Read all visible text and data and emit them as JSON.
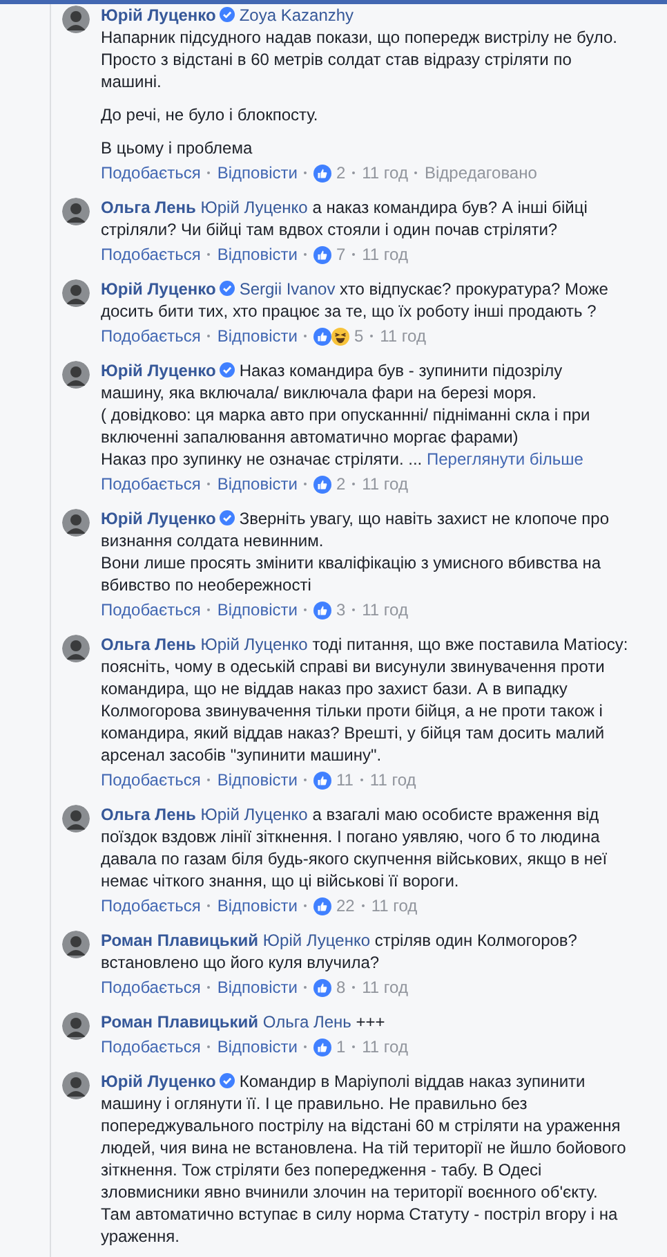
{
  "comments": [
    {
      "author": "Юрій Луценко",
      "verified": true,
      "mention": "Zoya Kazanzhy",
      "text": "\nНапарник підсудного надав покази, що попередж вистрілу не було. Просто з відстані в 60 метрів солдат став відразу стріляти по машині.\n\nДо речі, не було і блокпосту.\n\nВ цьому і проблема",
      "like": "Подобається",
      "reply": "Відповісти",
      "reactions": [
        {
          "kind": "like"
        }
      ],
      "count": "2",
      "time": "11 год",
      "edited": "Відредаговано"
    },
    {
      "author": "Ольга Лень",
      "verified": false,
      "mention": "Юрій Луценко",
      "text": "а наказ командира був? А інші бійці стріляли? Чи бійці там вдвох стояли і один почав стріляти?",
      "like": "Подобається",
      "reply": "Відповісти",
      "reactions": [
        {
          "kind": "like"
        }
      ],
      "count": "7",
      "time": "11 год"
    },
    {
      "author": "Юрій Луценко",
      "verified": true,
      "mention": "Sergii Ivanov",
      "text": "хто відпускає? прокуратура? Може досить бити тих, хто працює за те, що їх роботу інші продають ?",
      "like": "Подобається",
      "reply": "Відповісти",
      "reactions": [
        {
          "kind": "like"
        },
        {
          "kind": "haha"
        }
      ],
      "count": "5",
      "time": "11 год"
    },
    {
      "author": "Юрій Луценко",
      "verified": true,
      "text": "Наказ командира був - зупинити підозрілу машину, яка включала/ виключала фари на березі моря.\n( довідково: ця марка авто при опусканнні/ підніманні скла і при включенні запалювання автоматично моргає фарами)\nНаказ про зупинку не означає стріляти. ...",
      "see_more": "Переглянути більше",
      "like": "Подобається",
      "reply": "Відповісти",
      "reactions": [
        {
          "kind": "like"
        }
      ],
      "count": "2",
      "time": "11 год"
    },
    {
      "author": "Юрій Луценко",
      "verified": true,
      "text": "Зверніть увагу, що навіть захист не клопоче про визнання солдата невинним.\nВони лише просять змінити кваліфікацію з умисного вбивства на вбивство по необережності",
      "like": "Подобається",
      "reply": "Відповісти",
      "reactions": [
        {
          "kind": "like"
        }
      ],
      "count": "3",
      "time": "11 год"
    },
    {
      "author": "Ольга Лень",
      "verified": false,
      "mention": "Юрій Луценко",
      "text": "тоді питання, що вже поставила Матіосу: поясніть, чому в одеській справі ви висунули звинувачення проти командира, що не віддав наказ про захист бази. А в випадку Колмогорова звинувачення тільки проти бійця, а не проти також і командира, який віддав наказ? Врешті, у бійця там досить малий арсенал засобів \"зупинити машину\".",
      "like": "Подобається",
      "reply": "Відповісти",
      "reactions": [
        {
          "kind": "like"
        }
      ],
      "count": "11",
      "time": "11 год"
    },
    {
      "author": "Ольга Лень",
      "verified": false,
      "mention": "Юрій Луценко",
      "text": "а взагалі маю особисте враження від поїздок вздовж лінії зіткнення. І погано уявляю, чого б то людина давала по газам біля будь-якого скупчення військових, якщо в неї немає чіткого знання, що ці військові її вороги.",
      "like": "Подобається",
      "reply": "Відповісти",
      "reactions": [
        {
          "kind": "like"
        }
      ],
      "count": "22",
      "time": "11 год"
    },
    {
      "author": "Роман Плавицький",
      "verified": false,
      "mention": "Юрій Луценко",
      "text": "стріляв один Колмогоров? встановлено що його куля влучила?",
      "like": "Подобається",
      "reply": "Відповісти",
      "reactions": [
        {
          "kind": "like"
        }
      ],
      "count": "8",
      "time": "11 год"
    },
    {
      "author": "Роман Плавицький",
      "verified": false,
      "mention": "Ольга Лень",
      "text": "+++",
      "like": "Подобається",
      "reply": "Відповісти",
      "reactions": [
        {
          "kind": "like"
        }
      ],
      "count": "1",
      "time": "11 год"
    },
    {
      "author": "Юрій Луценко",
      "verified": true,
      "text": "Командир в Маріуполі віддав наказ зупинити машину і оглянути її. І це правильно. Не правильно без попереджувального пострілу на відстані 60 м стріляти на ураження людей, чия вина не встановлена. На тій території не йшло бойового зіткнення. Тож стріляти без попередження - табу. В Одесі зловмисники явно вчинили злочин на території воєнного об'єкту. Там автоматично вступає в силу норма Статуту - постріл вгору і на ураження."
    }
  ]
}
